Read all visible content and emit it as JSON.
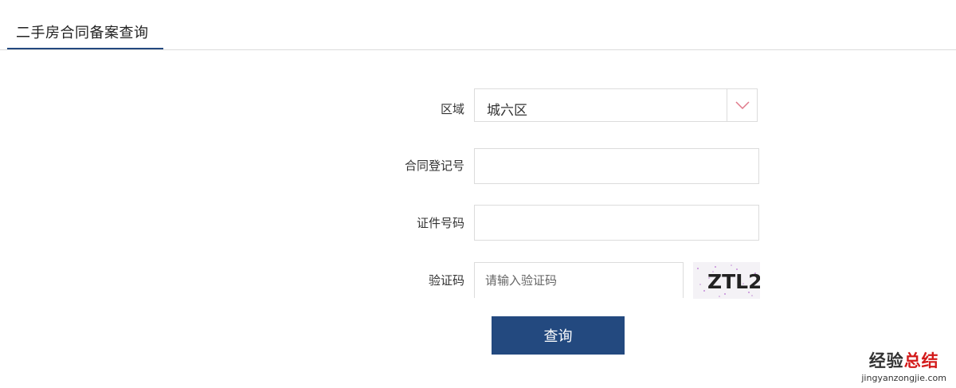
{
  "tab": {
    "label": "二手房合同备案查询"
  },
  "form": {
    "district": {
      "label": "区域",
      "value": "城六区"
    },
    "contract_no": {
      "label": "合同登记号",
      "value": ""
    },
    "id_no": {
      "label": "证件号码",
      "value": ""
    },
    "captcha": {
      "label": "验证码",
      "placeholder": "请输入验证码",
      "value": "",
      "image_text": "ZTL2"
    },
    "submit_label": "查询"
  },
  "watermark": {
    "brand_black": "经验",
    "brand_red": "总结",
    "url": "jingyanzongjie.com"
  },
  "colors": {
    "primary": "#23497f",
    "border": "#dcdcdc",
    "arrow": "#e0798a"
  }
}
